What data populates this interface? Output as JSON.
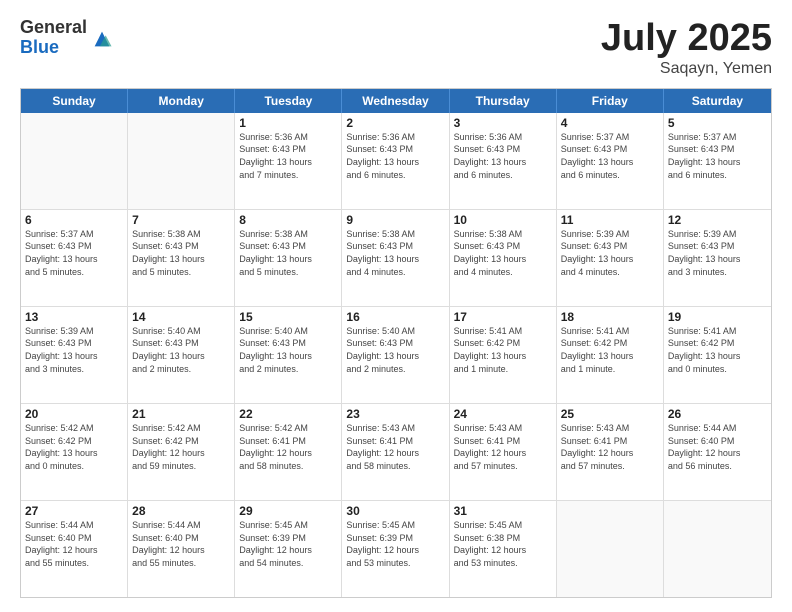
{
  "logo": {
    "general": "General",
    "blue": "Blue"
  },
  "title": "July 2025",
  "subtitle": "Saqayn, Yemen",
  "days": [
    "Sunday",
    "Monday",
    "Tuesday",
    "Wednesday",
    "Thursday",
    "Friday",
    "Saturday"
  ],
  "weeks": [
    [
      {
        "day": "",
        "info": ""
      },
      {
        "day": "",
        "info": ""
      },
      {
        "day": "1",
        "info": "Sunrise: 5:36 AM\nSunset: 6:43 PM\nDaylight: 13 hours\nand 7 minutes."
      },
      {
        "day": "2",
        "info": "Sunrise: 5:36 AM\nSunset: 6:43 PM\nDaylight: 13 hours\nand 6 minutes."
      },
      {
        "day": "3",
        "info": "Sunrise: 5:36 AM\nSunset: 6:43 PM\nDaylight: 13 hours\nand 6 minutes."
      },
      {
        "day": "4",
        "info": "Sunrise: 5:37 AM\nSunset: 6:43 PM\nDaylight: 13 hours\nand 6 minutes."
      },
      {
        "day": "5",
        "info": "Sunrise: 5:37 AM\nSunset: 6:43 PM\nDaylight: 13 hours\nand 6 minutes."
      }
    ],
    [
      {
        "day": "6",
        "info": "Sunrise: 5:37 AM\nSunset: 6:43 PM\nDaylight: 13 hours\nand 5 minutes."
      },
      {
        "day": "7",
        "info": "Sunrise: 5:38 AM\nSunset: 6:43 PM\nDaylight: 13 hours\nand 5 minutes."
      },
      {
        "day": "8",
        "info": "Sunrise: 5:38 AM\nSunset: 6:43 PM\nDaylight: 13 hours\nand 5 minutes."
      },
      {
        "day": "9",
        "info": "Sunrise: 5:38 AM\nSunset: 6:43 PM\nDaylight: 13 hours\nand 4 minutes."
      },
      {
        "day": "10",
        "info": "Sunrise: 5:38 AM\nSunset: 6:43 PM\nDaylight: 13 hours\nand 4 minutes."
      },
      {
        "day": "11",
        "info": "Sunrise: 5:39 AM\nSunset: 6:43 PM\nDaylight: 13 hours\nand 4 minutes."
      },
      {
        "day": "12",
        "info": "Sunrise: 5:39 AM\nSunset: 6:43 PM\nDaylight: 13 hours\nand 3 minutes."
      }
    ],
    [
      {
        "day": "13",
        "info": "Sunrise: 5:39 AM\nSunset: 6:43 PM\nDaylight: 13 hours\nand 3 minutes."
      },
      {
        "day": "14",
        "info": "Sunrise: 5:40 AM\nSunset: 6:43 PM\nDaylight: 13 hours\nand 2 minutes."
      },
      {
        "day": "15",
        "info": "Sunrise: 5:40 AM\nSunset: 6:43 PM\nDaylight: 13 hours\nand 2 minutes."
      },
      {
        "day": "16",
        "info": "Sunrise: 5:40 AM\nSunset: 6:43 PM\nDaylight: 13 hours\nand 2 minutes."
      },
      {
        "day": "17",
        "info": "Sunrise: 5:41 AM\nSunset: 6:42 PM\nDaylight: 13 hours\nand 1 minute."
      },
      {
        "day": "18",
        "info": "Sunrise: 5:41 AM\nSunset: 6:42 PM\nDaylight: 13 hours\nand 1 minute."
      },
      {
        "day": "19",
        "info": "Sunrise: 5:41 AM\nSunset: 6:42 PM\nDaylight: 13 hours\nand 0 minutes."
      }
    ],
    [
      {
        "day": "20",
        "info": "Sunrise: 5:42 AM\nSunset: 6:42 PM\nDaylight: 13 hours\nand 0 minutes."
      },
      {
        "day": "21",
        "info": "Sunrise: 5:42 AM\nSunset: 6:42 PM\nDaylight: 12 hours\nand 59 minutes."
      },
      {
        "day": "22",
        "info": "Sunrise: 5:42 AM\nSunset: 6:41 PM\nDaylight: 12 hours\nand 58 minutes."
      },
      {
        "day": "23",
        "info": "Sunrise: 5:43 AM\nSunset: 6:41 PM\nDaylight: 12 hours\nand 58 minutes."
      },
      {
        "day": "24",
        "info": "Sunrise: 5:43 AM\nSunset: 6:41 PM\nDaylight: 12 hours\nand 57 minutes."
      },
      {
        "day": "25",
        "info": "Sunrise: 5:43 AM\nSunset: 6:41 PM\nDaylight: 12 hours\nand 57 minutes."
      },
      {
        "day": "26",
        "info": "Sunrise: 5:44 AM\nSunset: 6:40 PM\nDaylight: 12 hours\nand 56 minutes."
      }
    ],
    [
      {
        "day": "27",
        "info": "Sunrise: 5:44 AM\nSunset: 6:40 PM\nDaylight: 12 hours\nand 55 minutes."
      },
      {
        "day": "28",
        "info": "Sunrise: 5:44 AM\nSunset: 6:40 PM\nDaylight: 12 hours\nand 55 minutes."
      },
      {
        "day": "29",
        "info": "Sunrise: 5:45 AM\nSunset: 6:39 PM\nDaylight: 12 hours\nand 54 minutes."
      },
      {
        "day": "30",
        "info": "Sunrise: 5:45 AM\nSunset: 6:39 PM\nDaylight: 12 hours\nand 53 minutes."
      },
      {
        "day": "31",
        "info": "Sunrise: 5:45 AM\nSunset: 6:38 PM\nDaylight: 12 hours\nand 53 minutes."
      },
      {
        "day": "",
        "info": ""
      },
      {
        "day": "",
        "info": ""
      }
    ]
  ]
}
